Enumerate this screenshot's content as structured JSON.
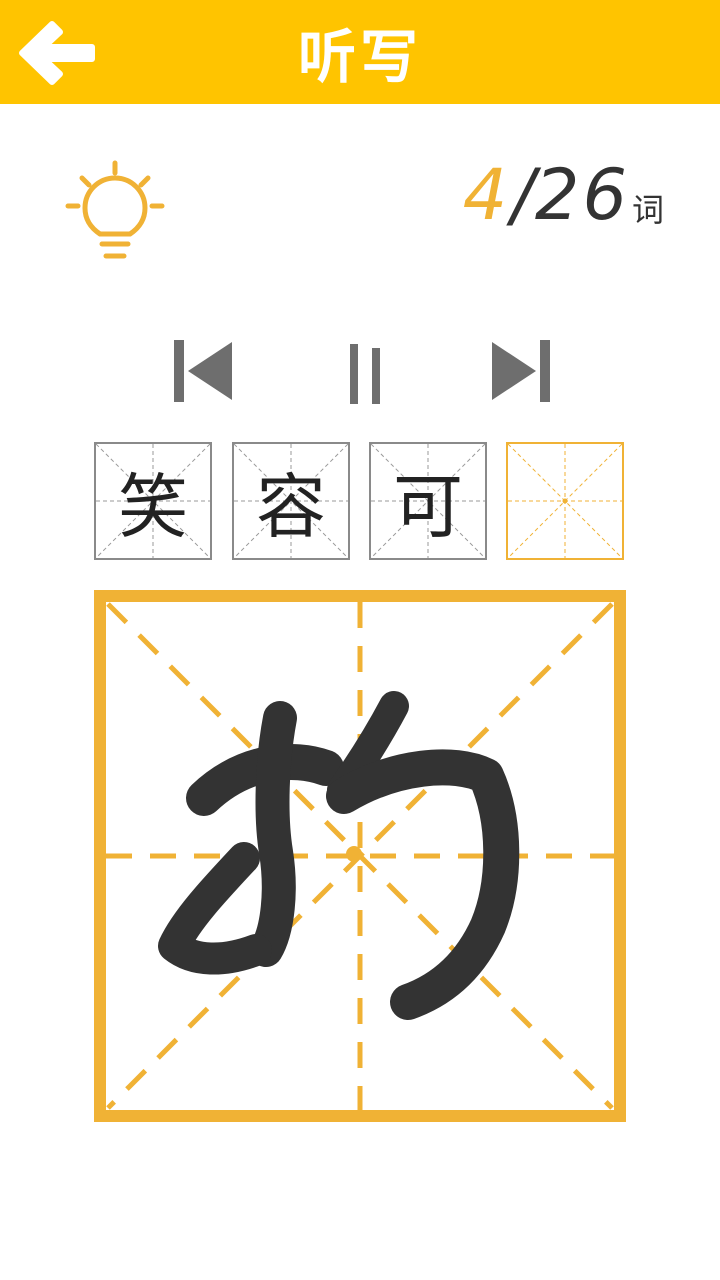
{
  "header": {
    "title": "听写",
    "back_icon": "arrow-left-icon"
  },
  "toolbar": {
    "hint_icon": "lightbulb-icon"
  },
  "progress": {
    "current": "4",
    "separator": "/",
    "total": "26",
    "unit": "词"
  },
  "controls": {
    "previous_icon": "skip-previous-icon",
    "pause_icon": "pause-icon",
    "next_icon": "skip-next-icon"
  },
  "answer_cells": [
    {
      "char": "笑"
    },
    {
      "char": "容"
    },
    {
      "char": "可"
    },
    {
      "char": ""
    }
  ],
  "writing_board": {
    "state": "handwritten stroke in progress"
  },
  "colors": {
    "header_bg": "#ffc400",
    "accent": "#f0b235",
    "ink": "#333333",
    "grid_gray": "#8a8a8a"
  }
}
